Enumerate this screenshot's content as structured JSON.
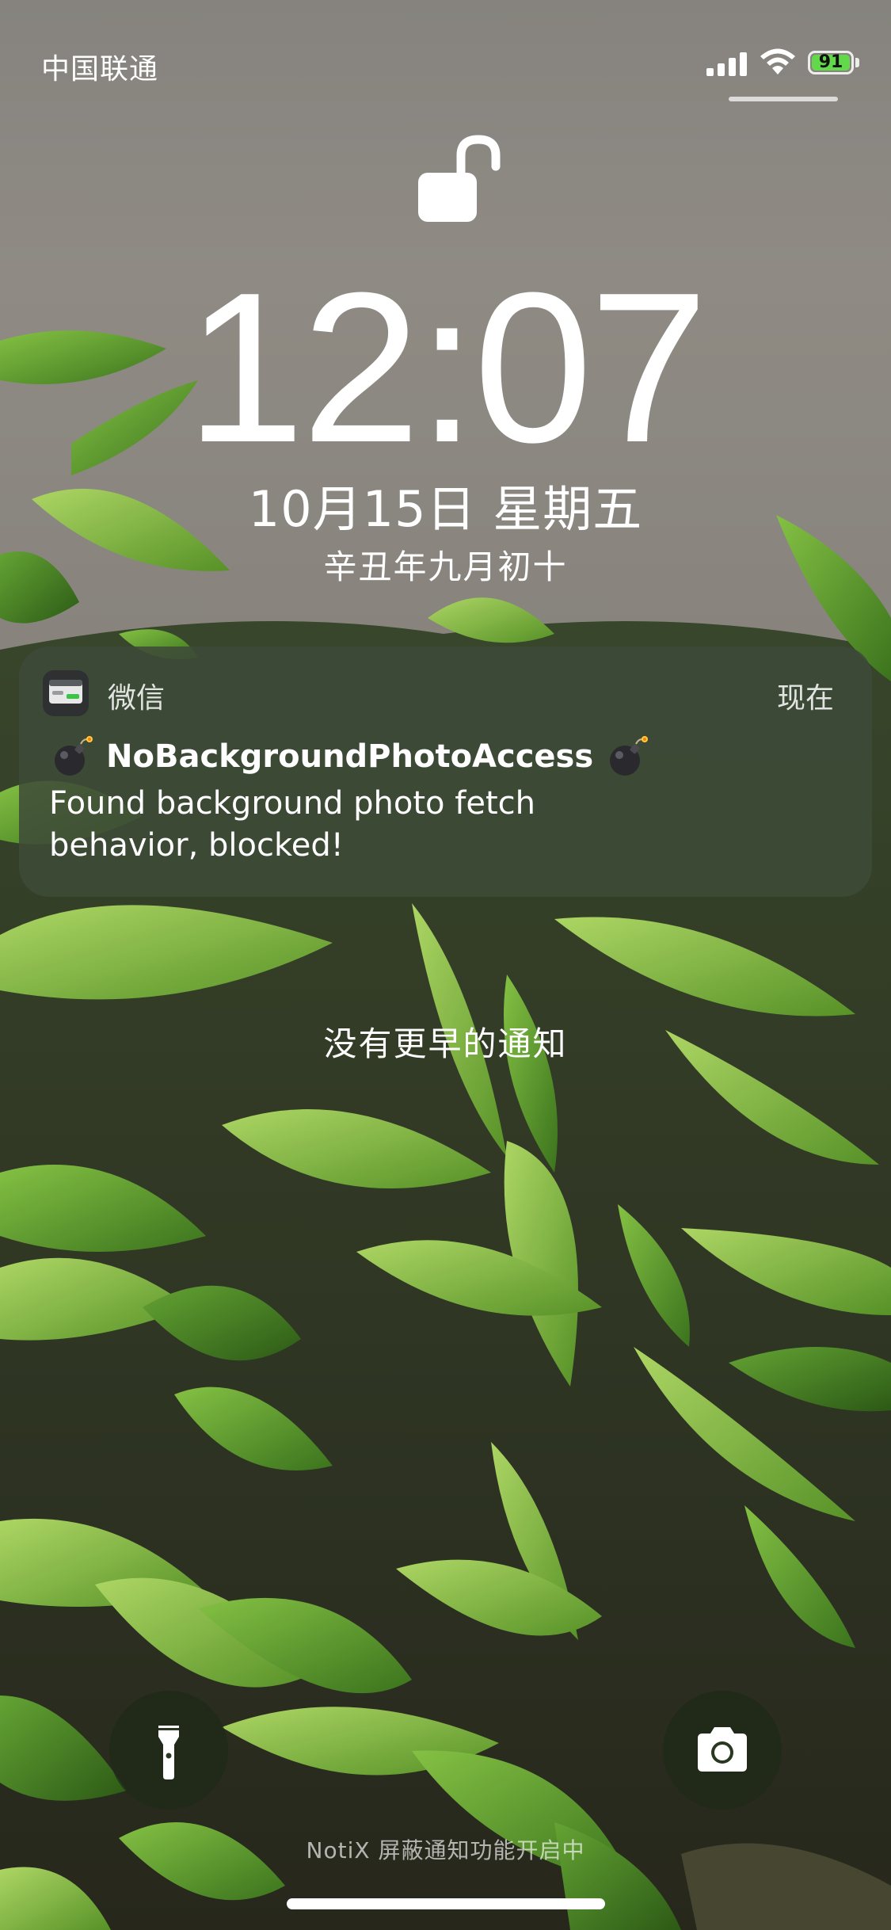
{
  "status_bar": {
    "carrier": "中国联通",
    "battery_level": "91",
    "signal_icon": "cellular-signal-icon",
    "wifi_icon": "wifi-icon"
  },
  "lock": {
    "icon": "unlocked-padlock-icon"
  },
  "clock": {
    "time": "12:07",
    "date": "10月15日 星期五",
    "lunar_date": "辛丑年九月初十"
  },
  "notification": {
    "app_name": "微信",
    "time": "现在",
    "title": "NoBackgroundPhotoAccess",
    "body": "Found background photo fetch behavior, blocked!",
    "title_icon": "bomb-icon"
  },
  "no_older_notifications": "没有更早的通知",
  "bottom": {
    "flashlight_icon": "flashlight-icon",
    "camera_icon": "camera-icon",
    "notix_text": "NotiX 屏蔽通知功能开启中"
  },
  "colors": {
    "battery_fill": "#62d94a",
    "notification_bg": "#3e4a38",
    "text": "#ffffff"
  }
}
